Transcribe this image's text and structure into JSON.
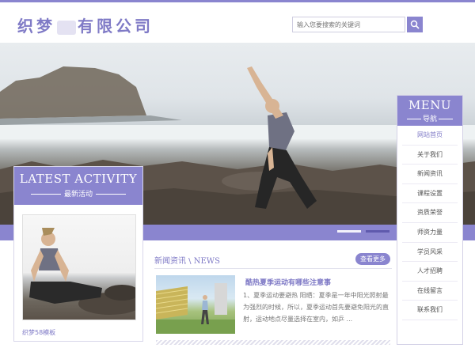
{
  "header": {
    "logo_part1": "织梦",
    "logo_part2": "有限公司",
    "search_placeholder": "输入您要搜索的关键词"
  },
  "banner": {
    "slides_count": 2,
    "active_slide": 2
  },
  "activity": {
    "title": "LATEST ACTIVITY",
    "subtitle": "最新活动",
    "caption": "织梦58模板"
  },
  "news": {
    "title_cn": "新闻资讯",
    "title_sep": " \\ ",
    "title_en": "NEWS",
    "more_label": "查看更多",
    "headline": "酷热夏季运动有哪些注意事",
    "body": "1、夏季运动要避热 阳晒：夏季是一年中阳光照射最为强烈的时候，所以，夏季运动首先要避免阳光的直射，运动地点尽量选择在室内，如乒 ..."
  },
  "menu": {
    "title": "MENU",
    "subtitle": "导航",
    "items": [
      {
        "label": "网站首页"
      },
      {
        "label": "关于我们"
      },
      {
        "label": "新闻资讯"
      },
      {
        "label": "课程设置"
      },
      {
        "label": "资质荣誉"
      },
      {
        "label": "师资力量"
      },
      {
        "label": "学员风采"
      },
      {
        "label": "人才招聘"
      },
      {
        "label": "在线留言"
      },
      {
        "label": "联系我们"
      }
    ]
  },
  "colors": {
    "accent": "#8a85cf",
    "accent_text": "#7f7ac6"
  },
  "icons": {
    "search": "search-icon"
  }
}
